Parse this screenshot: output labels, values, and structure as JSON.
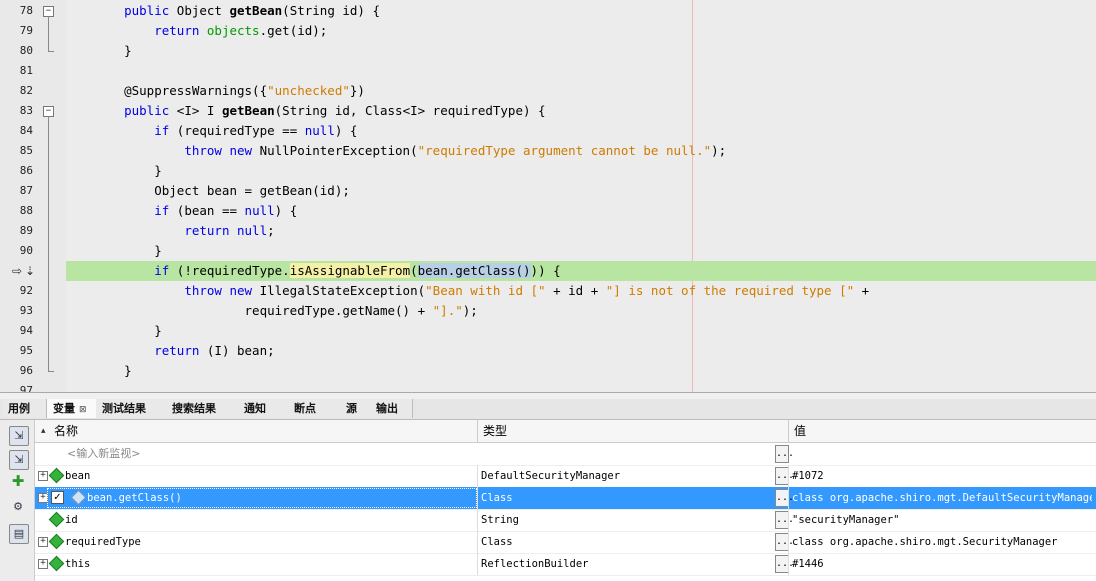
{
  "editor": {
    "lines": [
      {
        "num": "78",
        "fold": "minus",
        "html": "    <span class=\"kw\">public</span> Object <span class=\"bold\">getBean</span>(String id) {"
      },
      {
        "num": "79",
        "html": "        <span class=\"kw\">return</span> <span class=\"fld\">objects</span>.get(id);"
      },
      {
        "num": "80",
        "foldend": true,
        "html": "    }"
      },
      {
        "num": "81",
        "html": ""
      },
      {
        "num": "82",
        "html": "    @SuppressWarnings({<span class=\"str\">\"unchecked\"</span>})"
      },
      {
        "num": "83",
        "fold": "minus",
        "html": "    <span class=\"kw\">public</span> &lt;I&gt; I <span class=\"bold\">getBean</span>(String id, Class&lt;I&gt; requiredType) {"
      },
      {
        "num": "84",
        "html": "        <span class=\"kw\">if</span> (requiredType == <span class=\"kw\">null</span>) {"
      },
      {
        "num": "85",
        "html": "            <span class=\"kw\">throw new</span> NullPointerException(<span class=\"str\">\"requiredType argument cannot be null.\"</span>);"
      },
      {
        "num": "86",
        "html": "        }"
      },
      {
        "num": "87",
        "html": "        Object bean = getBean(id);"
      },
      {
        "num": "88",
        "html": "        <span class=\"kw\">if</span> (bean == <span class=\"kw\">null</span>) {"
      },
      {
        "num": "89",
        "html": "            <span class=\"kw\">return null</span>;"
      },
      {
        "num": "90",
        "html": "        }"
      },
      {
        "num": "",
        "current": true,
        "html": "        <span class=\"kw\">if</span> (!requiredType.<span class=\"hl-yellow\">isAssignableFrom</span>(<span class=\"hl-blue\">bean.getClass()</span>)) {"
      },
      {
        "num": "92",
        "html": "            <span class=\"kw\">throw new</span> IllegalStateException(<span class=\"str\">\"Bean with id [\"</span> + id + <span class=\"str\">\"] is not of the required type [\"</span> +"
      },
      {
        "num": "93",
        "html": "                    requiredType.getName() + <span class=\"str\">\"].\"</span>);"
      },
      {
        "num": "94",
        "html": "        }"
      },
      {
        "num": "95",
        "html": "        <span class=\"kw\">return</span> (I) bean;"
      },
      {
        "num": "96",
        "foldend": true,
        "html": "    }"
      },
      {
        "num": "97",
        "html": ""
      }
    ]
  },
  "tabs": [
    {
      "label": "用例"
    },
    {
      "label": "变量",
      "active": true,
      "close": "⊠"
    },
    {
      "label": "测试结果"
    },
    {
      "label": "搜索结果"
    },
    {
      "label": "通知"
    },
    {
      "label": "断点"
    },
    {
      "label": "源"
    },
    {
      "label": "输出"
    }
  ],
  "vars": {
    "header": {
      "sort": "▴",
      "name": "名称",
      "type": "类型",
      "value": "值"
    },
    "watch_placeholder": "<输入新监视>",
    "rows": [
      {
        "name": "bean",
        "type": "DefaultSecurityManager",
        "value": "#1072",
        "expandable": true
      },
      {
        "name": "bean.getClass()",
        "type": "Class",
        "value": "class org.apache.shiro.mgt.DefaultSecurityManager",
        "expandable": true,
        "selected": true,
        "watch": true,
        "checked": "✓"
      },
      {
        "name": "id",
        "type": "String",
        "value": "\"securityManager\"",
        "expandable": false
      },
      {
        "name": "requiredType",
        "type": "Class",
        "value": "class org.apache.shiro.mgt.SecurityManager",
        "expandable": true
      },
      {
        "name": "this",
        "type": "ReflectionBuilder",
        "value": "#1446",
        "expandable": true
      }
    ],
    "ellipsis": "..."
  }
}
